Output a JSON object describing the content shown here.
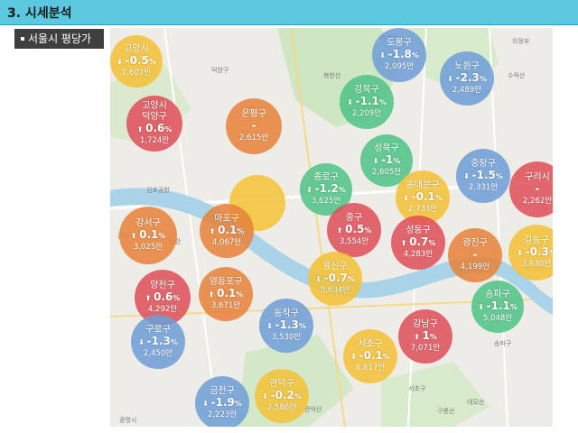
{
  "header": {
    "title": "3. 시세분석"
  },
  "section": {
    "label": "서울시 평당가"
  },
  "map_labels": [
    {
      "text": "덕양구"
    },
    {
      "text": "북한산"
    },
    {
      "text": "노원구"
    },
    {
      "text": "의정부"
    },
    {
      "text": "강서"
    },
    {
      "text": "김포공항"
    },
    {
      "text": "한강"
    },
    {
      "text": "광명시"
    },
    {
      "text": "서초구"
    },
    {
      "text": "관악산"
    },
    {
      "text": "구룡산"
    },
    {
      "text": "대모산"
    },
    {
      "text": "하남시"
    },
    {
      "text": "송파구"
    },
    {
      "text": "도봉산"
    },
    {
      "text": "수락산"
    }
  ],
  "districts": [
    {
      "name": "고양시",
      "arrow": "⬇",
      "rate": "-0.5",
      "pct": "%",
      "price": "1,607만",
      "color": "yellow"
    },
    {
      "name": "도봉구",
      "arrow": "⬇",
      "rate": "-1.8",
      "pct": "%",
      "price": "2,095만",
      "color": "blue"
    },
    {
      "name": "노원구",
      "arrow": "⬇",
      "rate": "-2.3",
      "pct": "%",
      "price": "2,489만",
      "color": "blue"
    },
    {
      "name": "강북구",
      "arrow": "⬇",
      "rate": "-1.1",
      "pct": "%",
      "price": "2,209만",
      "color": "green"
    },
    {
      "name": "고양시 덕양구",
      "arrow": "⬆",
      "rate": "0.6",
      "pct": "%",
      "price": "1,724만",
      "color": "red"
    },
    {
      "name": "은평구",
      "arrow": "",
      "rate": "-",
      "pct": "",
      "price": "2,615만",
      "color": "orange"
    },
    {
      "name": "성북구",
      "arrow": "⬇",
      "rate": "-1",
      "pct": "%",
      "price": "2,605만",
      "color": "green"
    },
    {
      "name": "중랑구",
      "arrow": "⬇",
      "rate": "-1.5",
      "pct": "%",
      "price": "2,331만",
      "color": "blue"
    },
    {
      "name": "구리시",
      "arrow": "",
      "rate": "-",
      "pct": "",
      "price": "2,262만",
      "color": "red"
    },
    {
      "name": "종로구",
      "arrow": "⬇",
      "rate": "-1.2",
      "pct": "%",
      "price": "3,625만",
      "color": "green"
    },
    {
      "name": "동대문구",
      "arrow": "⬇",
      "rate": "-0.1",
      "pct": "%",
      "price": "2,733만",
      "color": "yellow"
    },
    {
      "name": "",
      "arrow": "",
      "rate": "",
      "pct": "",
      "price": "",
      "color": "yellow"
    },
    {
      "name": "강서구",
      "arrow": "⬆",
      "rate": "0.1",
      "pct": "%",
      "price": "3,025만",
      "color": "orange"
    },
    {
      "name": "마포구",
      "arrow": "⬆",
      "rate": "0.1",
      "pct": "%",
      "price": "4,067만",
      "color": "orange"
    },
    {
      "name": "중구",
      "arrow": "⬆",
      "rate": "0.5",
      "pct": "%",
      "price": "3,554만",
      "color": "red"
    },
    {
      "name": "성동구",
      "arrow": "⬆",
      "rate": "0.7",
      "pct": "%",
      "price": "4,283만",
      "color": "red"
    },
    {
      "name": "광진구",
      "arrow": "",
      "rate": "-",
      "pct": "",
      "price": "4,199만",
      "color": "orange"
    },
    {
      "name": "강동구",
      "arrow": "⬇",
      "rate": "-0.3",
      "pct": "%",
      "price": "3,630만",
      "color": "yellow"
    },
    {
      "name": "용산구",
      "arrow": "⬇",
      "rate": "-0.7",
      "pct": "%",
      "price": "5,634만",
      "color": "yellow"
    },
    {
      "name": "양천구",
      "arrow": "⬆",
      "rate": "0.6",
      "pct": "%",
      "price": "4,292만",
      "color": "red"
    },
    {
      "name": "영등포구",
      "arrow": "⬆",
      "rate": "0.1",
      "pct": "%",
      "price": "3,671만",
      "color": "orange"
    },
    {
      "name": "송파구",
      "arrow": "⬇",
      "rate": "-1.1",
      "pct": "%",
      "price": "5,048만",
      "color": "green"
    },
    {
      "name": "동작구",
      "arrow": "⬇",
      "rate": "-1.3",
      "pct": "%",
      "price": "3,530만",
      "color": "blue"
    },
    {
      "name": "강남구",
      "arrow": "⬆",
      "rate": "1",
      "pct": "%",
      "price": "7,071만",
      "color": "red"
    },
    {
      "name": "구로구",
      "arrow": "⬇",
      "rate": "-1.3",
      "pct": "%",
      "price": "2,450만",
      "color": "blue"
    },
    {
      "name": "서초구",
      "arrow": "⬇",
      "rate": "-0.1",
      "pct": "%",
      "price": "6,817만",
      "color": "yellow"
    },
    {
      "name": "관악구",
      "arrow": "⬇",
      "rate": "-0.2",
      "pct": "%",
      "price": "2,586만",
      "color": "yellow"
    },
    {
      "name": "금천구",
      "arrow": "⬇",
      "rate": "-1.9",
      "pct": "%",
      "price": "2,223만",
      "color": "blue"
    }
  ]
}
